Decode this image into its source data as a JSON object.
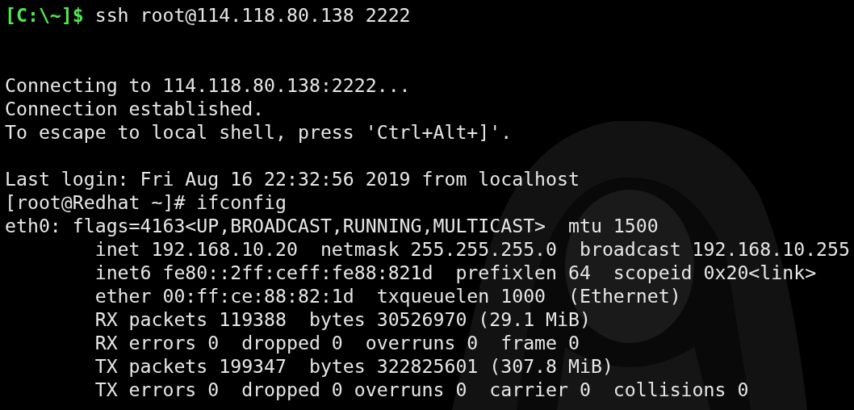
{
  "terminal": {
    "lines": [
      {
        "kind": "prompt",
        "prompt": "[C:\\~]$",
        "command": "ssh root@114.118.80.138 2222"
      },
      {
        "kind": "blank"
      },
      {
        "kind": "blank"
      },
      {
        "kind": "output",
        "text": "Connecting to 114.118.80.138:2222..."
      },
      {
        "kind": "output",
        "text": "Connection established."
      },
      {
        "kind": "output",
        "text": "To escape to local shell, press 'Ctrl+Alt+]'."
      },
      {
        "kind": "blank"
      },
      {
        "kind": "output",
        "text": "Last login: Fri Aug 16 22:32:56 2019 from localhost"
      },
      {
        "kind": "output",
        "text": "[root@Redhat ~]# ifconfig"
      },
      {
        "kind": "output",
        "text": "eth0: flags=4163<UP,BROADCAST,RUNNING,MULTICAST>  mtu 1500"
      },
      {
        "kind": "output",
        "text": "        inet 192.168.10.20  netmask 255.255.255.0  broadcast 192.168.10.255"
      },
      {
        "kind": "output",
        "text": "        inet6 fe80::2ff:ceff:fe88:821d  prefixlen 64  scopeid 0x20<link>"
      },
      {
        "kind": "output",
        "text": "        ether 00:ff:ce:88:82:1d  txqueuelen 1000  (Ethernet)"
      },
      {
        "kind": "output",
        "text": "        RX packets 119388  bytes 30526970 (29.1 MiB)"
      },
      {
        "kind": "output",
        "text": "        RX errors 0  dropped 0  overruns 0  frame 0"
      },
      {
        "kind": "output",
        "text": "        TX packets 199347  bytes 322825601 (307.8 MiB)"
      },
      {
        "kind": "output",
        "text": "        TX errors 0  dropped 0 overruns 0  carrier 0  collisions 0"
      }
    ]
  }
}
